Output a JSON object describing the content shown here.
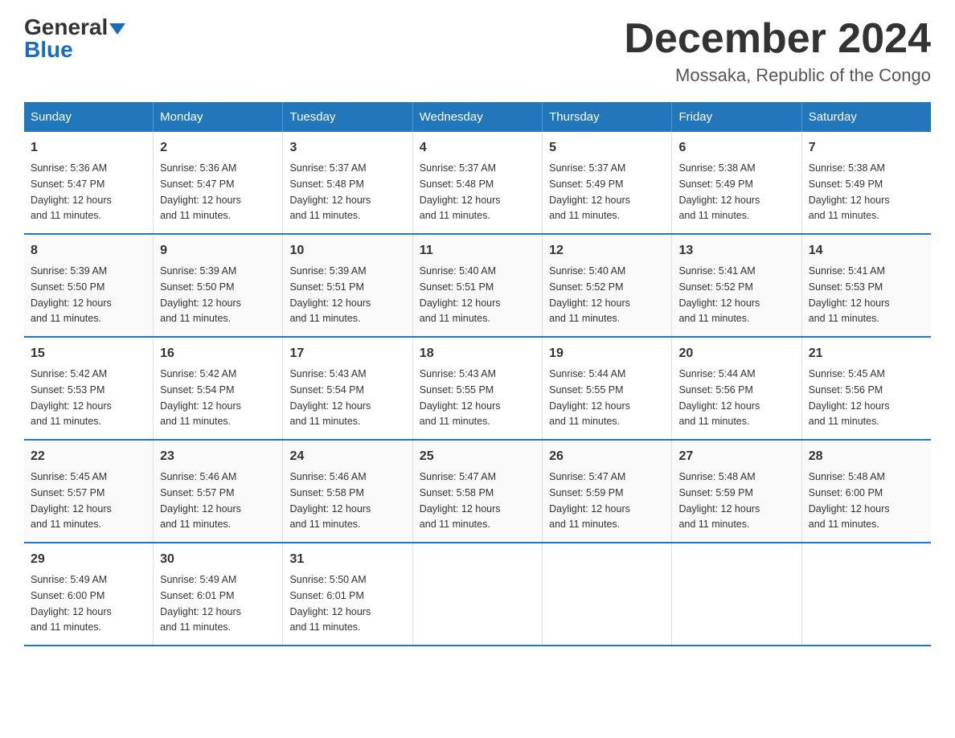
{
  "header": {
    "logo_general": "General",
    "logo_blue": "Blue",
    "month_title": "December 2024",
    "location": "Mossaka, Republic of the Congo"
  },
  "days_of_week": [
    "Sunday",
    "Monday",
    "Tuesday",
    "Wednesday",
    "Thursday",
    "Friday",
    "Saturday"
  ],
  "weeks": [
    [
      {
        "day": "1",
        "sunrise": "5:36 AM",
        "sunset": "5:47 PM",
        "daylight": "12 hours and 11 minutes."
      },
      {
        "day": "2",
        "sunrise": "5:36 AM",
        "sunset": "5:47 PM",
        "daylight": "12 hours and 11 minutes."
      },
      {
        "day": "3",
        "sunrise": "5:37 AM",
        "sunset": "5:48 PM",
        "daylight": "12 hours and 11 minutes."
      },
      {
        "day": "4",
        "sunrise": "5:37 AM",
        "sunset": "5:48 PM",
        "daylight": "12 hours and 11 minutes."
      },
      {
        "day": "5",
        "sunrise": "5:37 AM",
        "sunset": "5:49 PM",
        "daylight": "12 hours and 11 minutes."
      },
      {
        "day": "6",
        "sunrise": "5:38 AM",
        "sunset": "5:49 PM",
        "daylight": "12 hours and 11 minutes."
      },
      {
        "day": "7",
        "sunrise": "5:38 AM",
        "sunset": "5:49 PM",
        "daylight": "12 hours and 11 minutes."
      }
    ],
    [
      {
        "day": "8",
        "sunrise": "5:39 AM",
        "sunset": "5:50 PM",
        "daylight": "12 hours and 11 minutes."
      },
      {
        "day": "9",
        "sunrise": "5:39 AM",
        "sunset": "5:50 PM",
        "daylight": "12 hours and 11 minutes."
      },
      {
        "day": "10",
        "sunrise": "5:39 AM",
        "sunset": "5:51 PM",
        "daylight": "12 hours and 11 minutes."
      },
      {
        "day": "11",
        "sunrise": "5:40 AM",
        "sunset": "5:51 PM",
        "daylight": "12 hours and 11 minutes."
      },
      {
        "day": "12",
        "sunrise": "5:40 AM",
        "sunset": "5:52 PM",
        "daylight": "12 hours and 11 minutes."
      },
      {
        "day": "13",
        "sunrise": "5:41 AM",
        "sunset": "5:52 PM",
        "daylight": "12 hours and 11 minutes."
      },
      {
        "day": "14",
        "sunrise": "5:41 AM",
        "sunset": "5:53 PM",
        "daylight": "12 hours and 11 minutes."
      }
    ],
    [
      {
        "day": "15",
        "sunrise": "5:42 AM",
        "sunset": "5:53 PM",
        "daylight": "12 hours and 11 minutes."
      },
      {
        "day": "16",
        "sunrise": "5:42 AM",
        "sunset": "5:54 PM",
        "daylight": "12 hours and 11 minutes."
      },
      {
        "day": "17",
        "sunrise": "5:43 AM",
        "sunset": "5:54 PM",
        "daylight": "12 hours and 11 minutes."
      },
      {
        "day": "18",
        "sunrise": "5:43 AM",
        "sunset": "5:55 PM",
        "daylight": "12 hours and 11 minutes."
      },
      {
        "day": "19",
        "sunrise": "5:44 AM",
        "sunset": "5:55 PM",
        "daylight": "12 hours and 11 minutes."
      },
      {
        "day": "20",
        "sunrise": "5:44 AM",
        "sunset": "5:56 PM",
        "daylight": "12 hours and 11 minutes."
      },
      {
        "day": "21",
        "sunrise": "5:45 AM",
        "sunset": "5:56 PM",
        "daylight": "12 hours and 11 minutes."
      }
    ],
    [
      {
        "day": "22",
        "sunrise": "5:45 AM",
        "sunset": "5:57 PM",
        "daylight": "12 hours and 11 minutes."
      },
      {
        "day": "23",
        "sunrise": "5:46 AM",
        "sunset": "5:57 PM",
        "daylight": "12 hours and 11 minutes."
      },
      {
        "day": "24",
        "sunrise": "5:46 AM",
        "sunset": "5:58 PM",
        "daylight": "12 hours and 11 minutes."
      },
      {
        "day": "25",
        "sunrise": "5:47 AM",
        "sunset": "5:58 PM",
        "daylight": "12 hours and 11 minutes."
      },
      {
        "day": "26",
        "sunrise": "5:47 AM",
        "sunset": "5:59 PM",
        "daylight": "12 hours and 11 minutes."
      },
      {
        "day": "27",
        "sunrise": "5:48 AM",
        "sunset": "5:59 PM",
        "daylight": "12 hours and 11 minutes."
      },
      {
        "day": "28",
        "sunrise": "5:48 AM",
        "sunset": "6:00 PM",
        "daylight": "12 hours and 11 minutes."
      }
    ],
    [
      {
        "day": "29",
        "sunrise": "5:49 AM",
        "sunset": "6:00 PM",
        "daylight": "12 hours and 11 minutes."
      },
      {
        "day": "30",
        "sunrise": "5:49 AM",
        "sunset": "6:01 PM",
        "daylight": "12 hours and 11 minutes."
      },
      {
        "day": "31",
        "sunrise": "5:50 AM",
        "sunset": "6:01 PM",
        "daylight": "12 hours and 11 minutes."
      },
      null,
      null,
      null,
      null
    ]
  ],
  "labels": {
    "sunrise": "Sunrise:",
    "sunset": "Sunset:",
    "daylight": "Daylight:"
  }
}
